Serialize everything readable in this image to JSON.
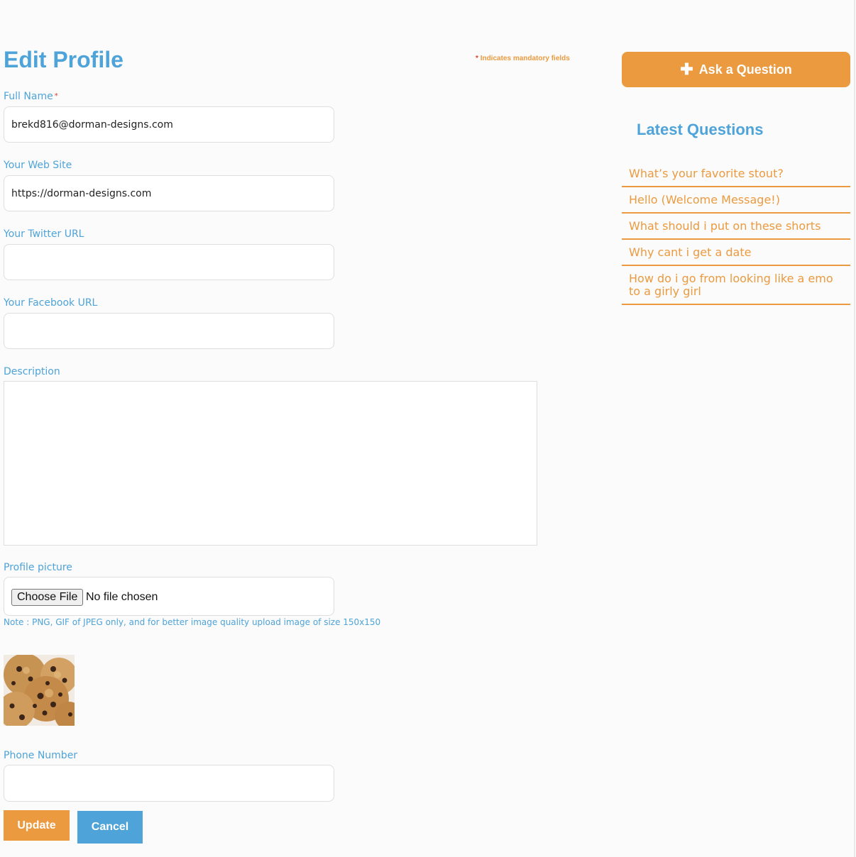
{
  "form": {
    "title": "Edit Profile",
    "mandatory_note": "Indicates mandatory fields",
    "mandatory_star": "*",
    "full_name": {
      "label": "Full Name",
      "required_mark": "*",
      "value": "brekd816@dorman-designs.com"
    },
    "web_site": {
      "label": "Your Web Site",
      "value": "https://dorman-designs.com"
    },
    "twitter": {
      "label": "Your Twitter URL",
      "value": ""
    },
    "facebook": {
      "label": "Your Facebook URL",
      "value": ""
    },
    "description": {
      "label": "Description",
      "value": ""
    },
    "profile_picture": {
      "label": "Profile picture",
      "button_label": "Choose File",
      "status": "No file chosen",
      "note": "Note : PNG, GIF of JPEG only, and for better image quality upload image of size 150x150"
    },
    "phone": {
      "label": "Phone Number",
      "value": ""
    },
    "update_label": "Update",
    "cancel_label": "Cancel"
  },
  "sidebar": {
    "ask_icon": "plus-icon",
    "ask_label": "Ask a Question",
    "latest_title": "Latest Questions",
    "questions": [
      "What’s your favorite stout?",
      "Hello (Welcome Message!)",
      "What should i put on these shorts",
      "Why cant i get a date",
      "How do i go from looking like a emo to a girly girl"
    ]
  },
  "colors": {
    "accent_blue": "#4ea3d8",
    "accent_orange": "#ec9a3f",
    "required_red": "#e23b2c"
  }
}
